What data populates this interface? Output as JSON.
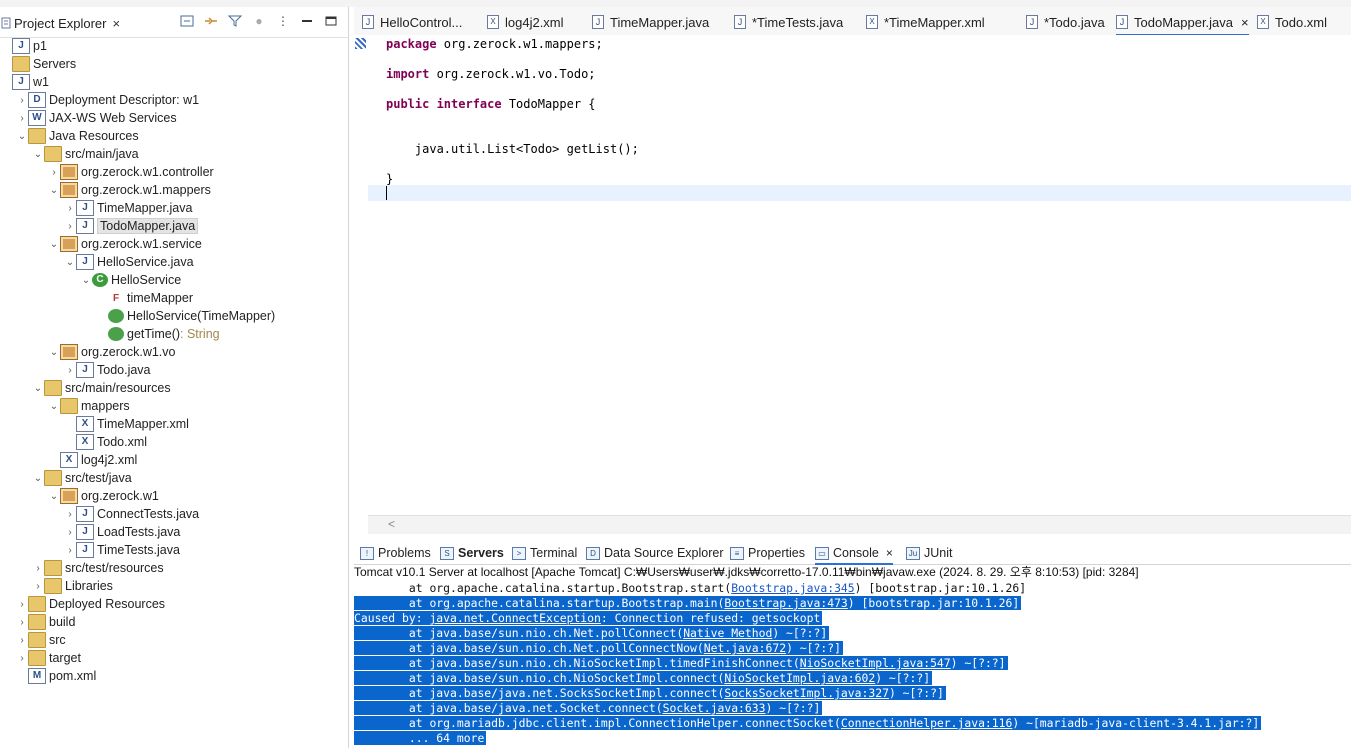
{
  "explorer": {
    "title": "Project Explorer",
    "close": "×",
    "tools": [
      "collapse-all-icon",
      "link-editor-icon",
      "filter-icon",
      "view-menu-icon",
      "minimize-icon",
      "maximize-icon"
    ],
    "tree": [
      {
        "label": "p1",
        "depth": 0,
        "chev": "",
        "icon": "project"
      },
      {
        "label": "Servers",
        "depth": 0,
        "chev": "",
        "icon": "folder"
      },
      {
        "label": "w1",
        "depth": 0,
        "chev": "",
        "icon": "project"
      },
      {
        "label": "Deployment Descriptor: w1",
        "depth": 1,
        "chev": "›",
        "icon": "descriptor"
      },
      {
        "label": "JAX-WS Web Services",
        "depth": 1,
        "chev": "›",
        "icon": "ws"
      },
      {
        "label": "Java Resources",
        "depth": 1,
        "chev": "⌄",
        "icon": "resources"
      },
      {
        "label": "src/main/java",
        "depth": 2,
        "chev": "⌄",
        "icon": "srcfolder"
      },
      {
        "label": "org.zerock.w1.controller",
        "depth": 3,
        "chev": "›",
        "icon": "package"
      },
      {
        "label": "org.zerock.w1.mappers",
        "depth": 3,
        "chev": "⌄",
        "icon": "package"
      },
      {
        "label": "TimeMapper.java",
        "depth": 4,
        "chev": "›",
        "icon": "java"
      },
      {
        "label": "TodoMapper.java",
        "depth": 4,
        "chev": "›",
        "icon": "java",
        "selected": true
      },
      {
        "label": "org.zerock.w1.service",
        "depth": 3,
        "chev": "⌄",
        "icon": "package"
      },
      {
        "label": "HelloService.java",
        "depth": 4,
        "chev": "⌄",
        "icon": "java"
      },
      {
        "label": "HelloService",
        "depth": 5,
        "chev": "⌄",
        "icon": "class"
      },
      {
        "label": "timeMapper",
        "depth": 6,
        "chev": "",
        "icon": "field"
      },
      {
        "label": "HelloService(TimeMapper)",
        "depth": 6,
        "chev": "",
        "icon": "constructor"
      },
      {
        "label": "getTime()",
        "depth": 6,
        "chev": "",
        "icon": "method",
        "suffix": " : String"
      },
      {
        "label": "org.zerock.w1.vo",
        "depth": 3,
        "chev": "⌄",
        "icon": "package"
      },
      {
        "label": "Todo.java",
        "depth": 4,
        "chev": "›",
        "icon": "java"
      },
      {
        "label": "src/main/resources",
        "depth": 2,
        "chev": "⌄",
        "icon": "srcfolder"
      },
      {
        "label": "mappers",
        "depth": 3,
        "chev": "⌄",
        "icon": "folder"
      },
      {
        "label": "TimeMapper.xml",
        "depth": 4,
        "chev": "",
        "icon": "xml"
      },
      {
        "label": "Todo.xml",
        "depth": 4,
        "chev": "",
        "icon": "xml"
      },
      {
        "label": "log4j2.xml",
        "depth": 3,
        "chev": "",
        "icon": "xml"
      },
      {
        "label": "src/test/java",
        "depth": 2,
        "chev": "⌄",
        "icon": "srcfolder"
      },
      {
        "label": "org.zerock.w1",
        "depth": 3,
        "chev": "⌄",
        "icon": "package"
      },
      {
        "label": "ConnectTests.java",
        "depth": 4,
        "chev": "›",
        "icon": "java"
      },
      {
        "label": "LoadTests.java",
        "depth": 4,
        "chev": "›",
        "icon": "java"
      },
      {
        "label": "TimeTests.java",
        "depth": 4,
        "chev": "›",
        "icon": "java"
      },
      {
        "label": "src/test/resources",
        "depth": 2,
        "chev": "›",
        "icon": "srcfolder"
      },
      {
        "label": "Libraries",
        "depth": 2,
        "chev": "›",
        "icon": "library"
      },
      {
        "label": "Deployed Resources",
        "depth": 1,
        "chev": "›",
        "icon": "folder"
      },
      {
        "label": "build",
        "depth": 1,
        "chev": "›",
        "icon": "folder"
      },
      {
        "label": "src",
        "depth": 1,
        "chev": "›",
        "icon": "folder"
      },
      {
        "label": "target",
        "depth": 1,
        "chev": "›",
        "icon": "folder"
      },
      {
        "label": "pom.xml",
        "depth": 1,
        "chev": "",
        "icon": "pom"
      }
    ]
  },
  "editor": {
    "tabs": [
      {
        "label": "HelloControl...",
        "icon": "java"
      },
      {
        "label": "log4j2.xml",
        "icon": "xml"
      },
      {
        "label": "TimeMapper.java",
        "icon": "java"
      },
      {
        "label": "*TimeTests.java",
        "icon": "java"
      },
      {
        "label": "*TimeMapper.xml",
        "icon": "xml"
      },
      {
        "label": "*Todo.java",
        "icon": "java"
      },
      {
        "label": "TodoMapper.java",
        "icon": "java",
        "active": true
      },
      {
        "label": "Todo.xml",
        "icon": "xml"
      }
    ],
    "code": [
      {
        "kw": "package",
        "rest": " org.zerock.w1.mappers;"
      },
      {
        "kw": "import",
        "rest": " org.zerock.w1.vo.Todo;"
      },
      {
        "kw": "public interface",
        "rest": " TodoMapper {"
      },
      {
        "kw": "",
        "rest": "    java.util.List<Todo> getList();"
      },
      {
        "kw": "",
        "rest": "}"
      }
    ],
    "scroll_left": "<"
  },
  "bottom": {
    "tabs": [
      {
        "label": "Problems",
        "icon": "problems-icon"
      },
      {
        "label": "Servers",
        "icon": "servers-icon",
        "bold": true
      },
      {
        "label": "Terminal",
        "icon": "terminal-icon"
      },
      {
        "label": "Data Source Explorer",
        "icon": "datasource-icon"
      },
      {
        "label": "Properties",
        "icon": "properties-icon"
      },
      {
        "label": "Console",
        "icon": "console-icon",
        "active": true
      },
      {
        "label": "JUnit",
        "icon": "junit-icon"
      }
    ],
    "console_description": "Tomcat v10.1 Server at localhost [Apache Tomcat] C:₩Users₩user₩.jdks₩corretto-17.0.11₩bin₩javaw.exe  (2024. 8. 29. 오후 8:10:53) [pid: 3284]",
    "console_lines": [
      {
        "indent": "        ",
        "pre": "at org.apache.catalina.startup.Bootstrap.start(",
        "link": "Bootstrap.java:345",
        "post": ") [bootstrap.jar:10.1.26]",
        "selected": false
      },
      {
        "indent": "        ",
        "pre": "at org.apache.catalina.startup.Bootstrap.main(",
        "link": "Bootstrap.java:473",
        "post": ") [bootstrap.jar:10.1.26]",
        "selected": true
      },
      {
        "indent": "",
        "pre": "Caused by: ",
        "link": "java.net.ConnectException",
        "post": ": Connection refused: getsockopt",
        "selected": true
      },
      {
        "indent": "        ",
        "pre": "at java.base/sun.nio.ch.Net.pollConnect(",
        "link": "Native Method",
        "post": ") ~[?:?]",
        "selected": true
      },
      {
        "indent": "        ",
        "pre": "at java.base/sun.nio.ch.Net.pollConnectNow(",
        "link": "Net.java:672",
        "post": ") ~[?:?]",
        "selected": true
      },
      {
        "indent": "        ",
        "pre": "at java.base/sun.nio.ch.NioSocketImpl.timedFinishConnect(",
        "link": "NioSocketImpl.java:547",
        "post": ") ~[?:?]",
        "selected": true
      },
      {
        "indent": "        ",
        "pre": "at java.base/sun.nio.ch.NioSocketImpl.connect(",
        "link": "NioSocketImpl.java:602",
        "post": ") ~[?:?]",
        "selected": true
      },
      {
        "indent": "        ",
        "pre": "at java.base/java.net.SocksSocketImpl.connect(",
        "link": "SocksSocketImpl.java:327",
        "post": ") ~[?:?]",
        "selected": true
      },
      {
        "indent": "        ",
        "pre": "at java.base/java.net.Socket.connect(",
        "link": "Socket.java:633",
        "post": ") ~[?:?]",
        "selected": true
      },
      {
        "indent": "        ",
        "pre": "at org.mariadb.jdbc.client.impl.ConnectionHelper.connectSocket(",
        "link": "ConnectionHelper.java:116",
        "post": ") ~[mariadb-java-client-3.4.1.jar:?]",
        "selected": true
      },
      {
        "indent": "        ",
        "pre": "... 64 more",
        "link": "",
        "post": "",
        "selected": true
      }
    ]
  },
  "colors": {
    "selection": "#0a66cc",
    "keyword": "#7f0055",
    "active_tab": "#2f6fd6"
  }
}
